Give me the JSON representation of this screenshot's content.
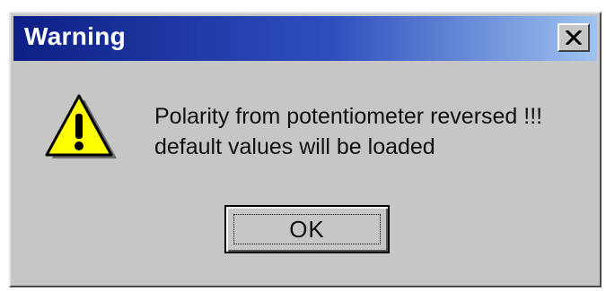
{
  "window": {
    "title": "Warning",
    "close_icon": "close-icon"
  },
  "icon": {
    "name": "warning-icon",
    "color": "#ffff00"
  },
  "message": {
    "line1": "Polarity from potentiometer reversed !!!",
    "line2": "default values will be loaded"
  },
  "buttons": {
    "ok_label": "OK"
  },
  "colors": {
    "titlebar_start": "#0d1f86",
    "titlebar_end": "#9fc3f0",
    "dialog_bg": "#c6c6c6"
  }
}
